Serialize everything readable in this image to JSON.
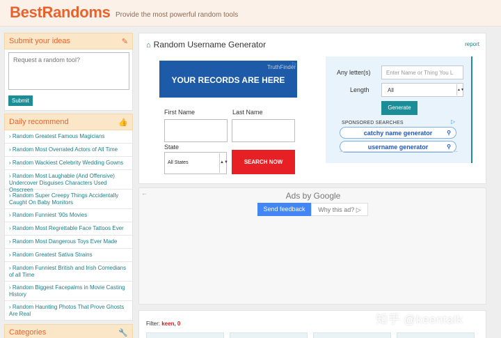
{
  "header": {
    "logo": "BestRandoms",
    "tagline": "Provide the most powerful random tools"
  },
  "sidebar": {
    "submit": {
      "title": "Submit your ideas",
      "icon": "edit-icon",
      "placeholder": "Request a random tool?",
      "button": "Submit"
    },
    "daily": {
      "title": "Daily recommend",
      "icon": "thumbs-up-icon",
      "items": [
        "› Random Greatest Famous Magicians",
        "› Random Most Overrated Actors of All Time",
        "› Random Wackiest Celebrity Wedding Gowns",
        "› Random Most Laughable (And Offensive) Undercover Disguises Characters Used Onscreen",
        "› Random Super Creepy Things Accidentally Caught On Baby Monitors",
        "› Random Funniest '90s Movies",
        "› Random Most Regrettable Face Tattoos Ever",
        "› Random Most Dangerous Toys Ever Made",
        "› Random Greatest Sativa Strains",
        "› Random Funniest British and Irish Comedians of all Time",
        "› Random Biggest Facepalms in Movie Casting History",
        "› Random Haunting Photos That Prove Ghosts Are Real"
      ]
    },
    "categories": {
      "title": "Categories",
      "icon": "wrench-icon"
    }
  },
  "tool": {
    "title": "Random Username Generator",
    "report": "report",
    "ad": {
      "brand": "TruthFinder",
      "adchoice": "▷",
      "headline": "YOUR RECORDS ARE HERE",
      "first_name": "First Name",
      "last_name": "Last Name",
      "state_label": "State",
      "state_value": "All States",
      "search_button": "SEARCH NOW"
    },
    "form": {
      "letters_label": "Any letter(s)",
      "letters_placeholder": "Enter Name or Thing You L",
      "length_label": "Length",
      "length_value": "All",
      "generate": "Generate",
      "sponsored_label": "SPONSORED SEARCHES",
      "sponsored_links": [
        "catchy name generator",
        "username generator"
      ]
    }
  },
  "google_ads": {
    "ads_by": "Ads by Google",
    "feedback": "Send feedback",
    "why": "Why this ad? ▷"
  },
  "filter": {
    "label": "Filter:",
    "value": "keen, 0"
  },
  "watermark": "知乎 @keentalk",
  "colors": {
    "brand_orange": "#e8632c",
    "teal": "#1b8d96",
    "ad_blue": "#1d5aa8",
    "search_red": "#e62025",
    "google_blue": "#4285f4"
  }
}
